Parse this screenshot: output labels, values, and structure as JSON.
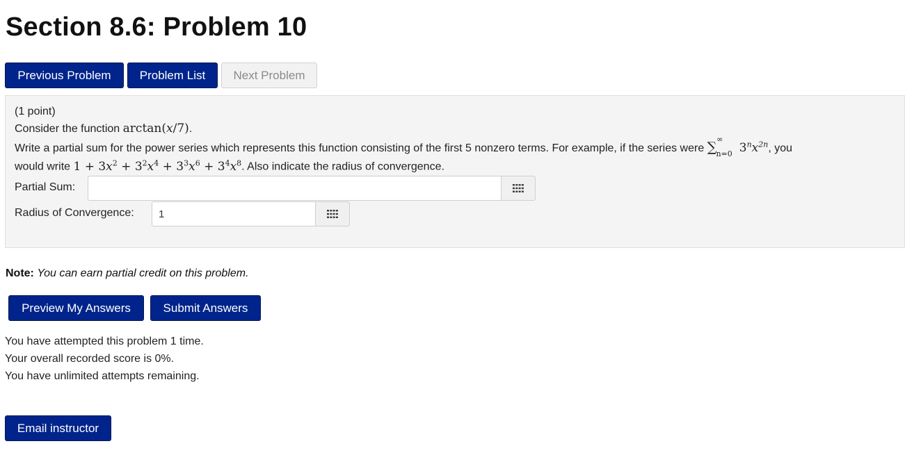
{
  "page": {
    "title": "Section 8.6: Problem 10"
  },
  "nav": {
    "previous_label": "Previous Problem",
    "list_label": "Problem List",
    "next_label": "Next Problem"
  },
  "problem": {
    "points": "(1 point)",
    "consider_prefix": "Consider the function ",
    "function_text": "arctan(",
    "function_var": "x",
    "function_tail": "/7)",
    "period": ".",
    "instruction": "Write a partial sum for the power series which represents this function consisting of the first 5 nonzero terms. For example, if the series were ",
    "series_sigma": "∑",
    "series_upper": "∞",
    "series_lower": "n=0",
    "series_base": "3",
    "series_base_exp": "n",
    "series_var": "x",
    "series_var_exp": "2n",
    "series_tail": ", you",
    "example_prefix": "would write ",
    "example_terms": [
      {
        "text": "1 + 3",
        "var": "x",
        "exp": "2"
      },
      {
        "text": " + 3",
        "pow": "2",
        "var": "x",
        "exp": "4"
      },
      {
        "text": " + 3",
        "pow": "3",
        "var": "x",
        "exp": "6"
      },
      {
        "text": " + 3",
        "pow": "4",
        "var": "x",
        "exp": "8"
      }
    ],
    "example_suffix": ". Also indicate the radius of convergence.",
    "partial_sum_label": "Partial Sum:",
    "partial_sum_value": "",
    "radius_label": "Radius of Convergence:",
    "radius_value": "1"
  },
  "note": {
    "label": "Note:",
    "text": "You can earn partial credit on this problem."
  },
  "actions": {
    "preview_label": "Preview My Answers",
    "submit_label": "Submit Answers"
  },
  "status": {
    "attempts": "You have attempted this problem 1 time.",
    "score": "Your overall recorded score is 0%.",
    "remaining": "You have unlimited attempts remaining."
  },
  "footer": {
    "email_label": "Email instructor"
  },
  "icons": {
    "keyboard": "keyboard-grid-icon"
  },
  "colors": {
    "primary": "#00248b",
    "panel": "#f4f4f4"
  }
}
